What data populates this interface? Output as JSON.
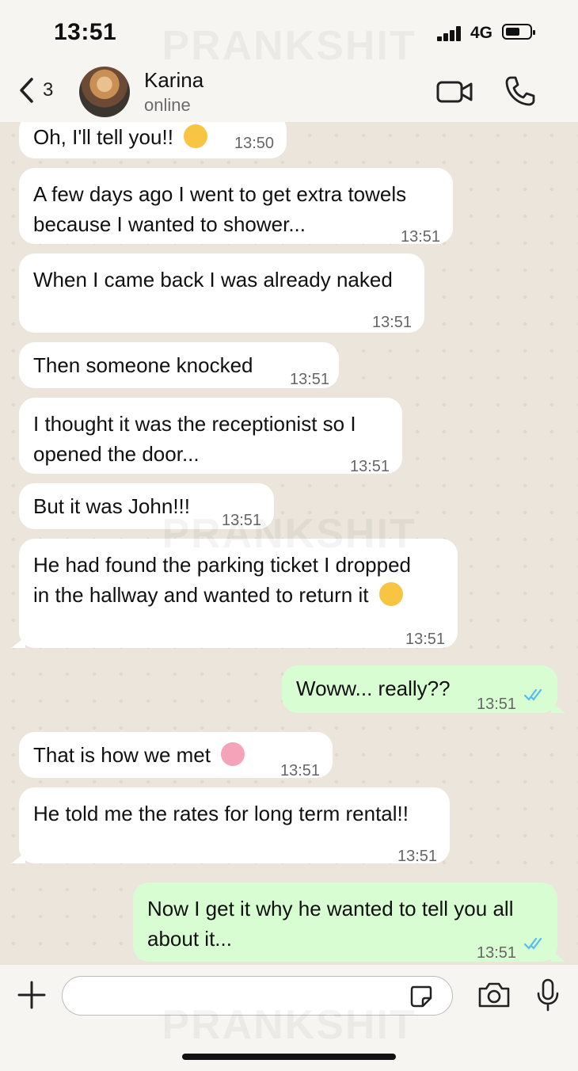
{
  "status": {
    "time": "13:51",
    "network": "4G"
  },
  "watermark": "PRANKSHIT",
  "header": {
    "back_count": "3",
    "name": "Karina",
    "presence": "online"
  },
  "messages": [
    {
      "text": "Oh, I'll tell you!! ",
      "time": "13:50",
      "dir": "in"
    },
    {
      "text": "A few days ago I went to get extra towels\nbecause I wanted to shower...",
      "time": "13:51",
      "dir": "in"
    },
    {
      "text": "When I came back I was already naked",
      "time": "13:51",
      "dir": "in"
    },
    {
      "text": "Then someone knocked",
      "time": "13:51",
      "dir": "in"
    },
    {
      "text": "I thought it was the receptionist so I\nopened the door...",
      "time": "13:51",
      "dir": "in"
    },
    {
      "text": "But it was John!!!",
      "time": "13:51",
      "dir": "in"
    },
    {
      "text": "He had found the parking ticket I dropped\nin the hallway and wanted to return it ",
      "time": "13:51",
      "dir": "in"
    },
    {
      "text": "Woww... really??",
      "time": "13:51",
      "dir": "out"
    },
    {
      "text": "That is how we met ",
      "time": "13:51",
      "dir": "in"
    },
    {
      "text": "He told me the rates for long term rental!!",
      "time": "13:51",
      "dir": "in"
    },
    {
      "text": "Now I get it why he wanted to tell you all\nabout it...",
      "time": "13:51",
      "dir": "out"
    }
  ],
  "colors": {
    "incoming": "#ffffff",
    "outgoing": "#d9fdd3",
    "read_ticks": "#53bdeb"
  },
  "icons": [
    "chevron-left-icon",
    "video-call-icon",
    "phone-icon",
    "plus-icon",
    "sticker-icon",
    "camera-icon",
    "mic-icon"
  ]
}
